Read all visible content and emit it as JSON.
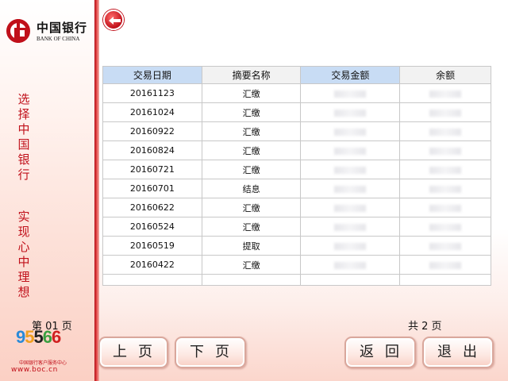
{
  "brand": {
    "name_cn": "中国银行",
    "name_en": "BANK OF CHINA"
  },
  "slogan": {
    "line1": [
      "选",
      "择",
      "中",
      "国",
      "银",
      "行"
    ],
    "line2": [
      "实",
      "现",
      "心",
      "中",
      "理",
      "想"
    ]
  },
  "hotline": {
    "digits": [
      "9",
      "5",
      "5",
      "6",
      "6"
    ],
    "caption": "中国银行客户服务中心",
    "url": "www.boc.cn"
  },
  "table": {
    "headers": [
      "交易日期",
      "摘要名称",
      "交易金额",
      "余额"
    ],
    "rows": [
      {
        "date": "20161123",
        "summary": "汇缴"
      },
      {
        "date": "20161024",
        "summary": "汇缴"
      },
      {
        "date": "20160922",
        "summary": "汇缴"
      },
      {
        "date": "20160824",
        "summary": "汇缴"
      },
      {
        "date": "20160721",
        "summary": "汇缴"
      },
      {
        "date": "20160701",
        "summary": "结息"
      },
      {
        "date": "20160622",
        "summary": "汇缴"
      },
      {
        "date": "20160524",
        "summary": "汇缴"
      },
      {
        "date": "20160519",
        "summary": "提取"
      },
      {
        "date": "20160422",
        "summary": "汇缴"
      }
    ]
  },
  "pagination": {
    "current": "第 01 页",
    "total": "共 2 页"
  },
  "buttons": {
    "prev": "上页",
    "next": "下页",
    "back": "返回",
    "exit": "退出"
  },
  "colors": {
    "brand_red": "#c0101a",
    "header_blue": "#c8dcf4"
  }
}
